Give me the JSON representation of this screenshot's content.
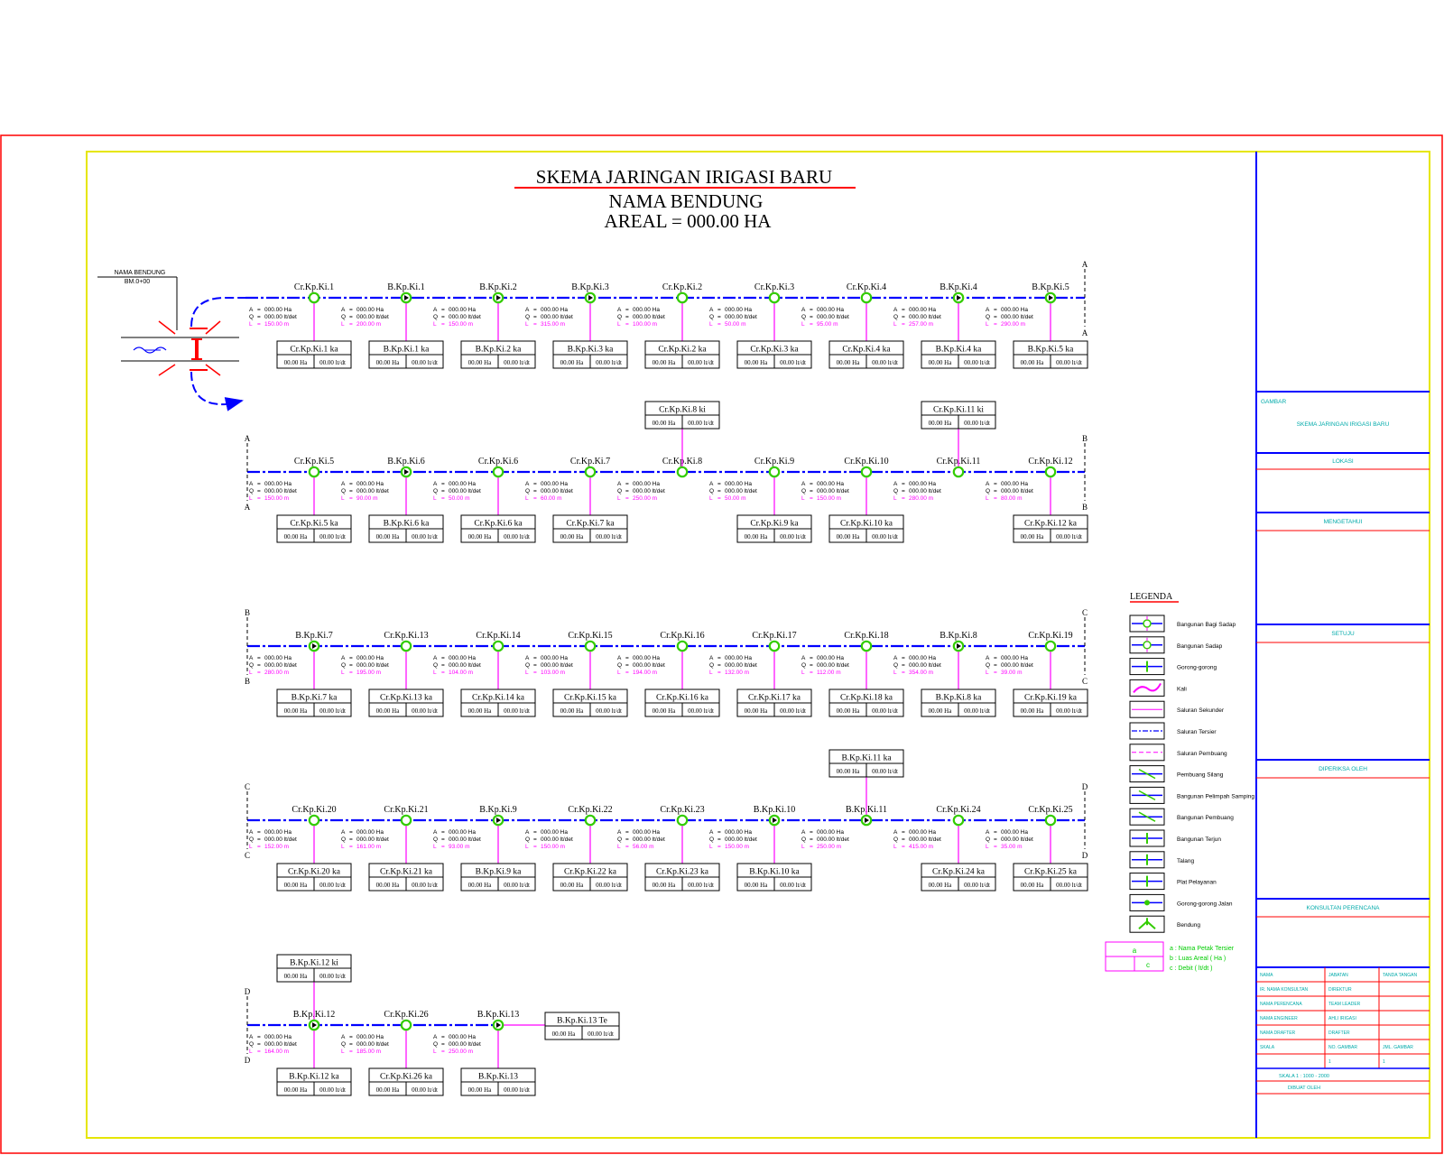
{
  "title": {
    "line1": "SKEMA JARINGAN IRIGASI BARU",
    "line2": "NAMA BENDUNG",
    "line3": "AREAL = 000.00 HA"
  },
  "colors": {
    "channel": "#0000ff",
    "offtake": "#ff00ff",
    "structure": "#33cc00",
    "border_outer": "#ff0000",
    "border_inner": "#ffff00",
    "legend_text": "#00cc00",
    "panel_text": "#00aaaa"
  },
  "weir": {
    "label": "NAMA BENDUNG",
    "sublabel": "BM.0+00"
  },
  "abl": {
    "a": "A",
    "q": "Q",
    "l": "L"
  },
  "rows": [
    {
      "start": null,
      "end": "A",
      "nodes": [
        {
          "name": "Cr.Kp.Ki.1",
          "type": "cross",
          "a": "000.00 Ha",
          "q": "000.00 lt/det",
          "l": "150.00 m",
          "off": "Cr.Kp.Ki.1 ka",
          "area": "00.00 Ha",
          "flow": "00.00 lt/dt"
        },
        {
          "name": "B.Kp.Ki.1",
          "type": "div",
          "a": "000.00 Ha",
          "q": "000.00 lt/det",
          "l": "200.00 m",
          "off": "B.Kp.Ki.1 ka",
          "area": "00.00 Ha",
          "flow": "00.00 lt/dt"
        },
        {
          "name": "B.Kp.Ki.2",
          "type": "div",
          "a": "000.00 Ha",
          "q": "000.00 lt/det",
          "l": "150.00 m",
          "off": "B.Kp.Ki.2 ka",
          "area": "00.00 Ha",
          "flow": "00.00 lt/dt"
        },
        {
          "name": "B.Kp.Ki.3",
          "type": "div",
          "a": "000.00 Ha",
          "q": "000.00 lt/det",
          "l": "315.00 m",
          "off": "B.Kp.Ki.3 ka",
          "area": "00.00 Ha",
          "flow": "00.00 lt/dt"
        },
        {
          "name": "Cr.Kp.Ki.2",
          "type": "cross",
          "a": "000.00 Ha",
          "q": "000.00 lt/det",
          "l": "100.00 m",
          "off": "Cr.Kp.Ki.2 ka",
          "area": "00.00 Ha",
          "flow": "00.00 lt/dt"
        },
        {
          "name": "Cr.Kp.Ki.3",
          "type": "cross",
          "a": "000.00 Ha",
          "q": "000.00 lt/det",
          "l": "50.00 m",
          "off": "Cr.Kp.Ki.3 ka",
          "area": "00.00 Ha",
          "flow": "00.00 lt/dt"
        },
        {
          "name": "Cr.Kp.Ki.4",
          "type": "cross",
          "a": "000.00 Ha",
          "q": "000.00 lt/det",
          "l": "95.00 m",
          "off": "Cr.Kp.Ki.4 ka",
          "area": "00.00 Ha",
          "flow": "00.00 lt/dt"
        },
        {
          "name": "B.Kp.Ki.4",
          "type": "div",
          "a": "000.00 Ha",
          "q": "000.00 lt/det",
          "l": "257.00 m",
          "off": "B.Kp.Ki.4 ka",
          "area": "00.00 Ha",
          "flow": "00.00 lt/dt"
        },
        {
          "name": "B.Kp.Ki.5",
          "type": "div",
          "a": "000.00 Ha",
          "q": "000.00 lt/det",
          "l": "290.00 m",
          "off": "B.Kp.Ki.5 ka",
          "area": "00.00 Ha",
          "flow": "00.00 lt/dt"
        }
      ]
    },
    {
      "start": "A",
      "end": "B",
      "nodes": [
        {
          "name": "Cr.Kp.Ki.5",
          "type": "cross",
          "a": "000.00 Ha",
          "q": "000.00 lt/det",
          "l": "150.00 m",
          "off": "Cr.Kp.Ki.5 ka",
          "area": "00.00 Ha",
          "flow": "00.00 lt/dt"
        },
        {
          "name": "B.Kp.Ki.6",
          "type": "div",
          "a": "000.00 Ha",
          "q": "000.00 lt/det",
          "l": "90.00 m",
          "off": "B.Kp.Ki.6 ka",
          "area": "00.00 Ha",
          "flow": "00.00 lt/dt"
        },
        {
          "name": "Cr.Kp.Ki.6",
          "type": "cross",
          "a": "000.00 Ha",
          "q": "000.00 lt/det",
          "l": "50.00 m",
          "off": "Cr.Kp.Ki.6 ka",
          "area": "00.00 Ha",
          "flow": "00.00 lt/dt"
        },
        {
          "name": "Cr.Kp.Ki.7",
          "type": "cross",
          "a": "000.00 Ha",
          "q": "000.00 lt/det",
          "l": "60.00 m",
          "off": "Cr.Kp.Ki.7 ka",
          "area": "00.00 Ha",
          "flow": "00.00 lt/dt"
        },
        {
          "name": "Cr.Kp.Ki.8",
          "type": "cross",
          "a": "000.00 Ha",
          "q": "000.00 lt/det",
          "l": "250.00 m",
          "top": "Cr.Kp.Ki.8 ki",
          "top_area": "00.00 Ha",
          "top_flow": "00.00 lt/dt"
        },
        {
          "name": "Cr.Kp.Ki.9",
          "type": "cross",
          "a": "000.00 Ha",
          "q": "000.00 lt/det",
          "l": "50.00 m",
          "off": "Cr.Kp.Ki.9 ka",
          "area": "00.00 Ha",
          "flow": "00.00 lt/dt"
        },
        {
          "name": "Cr.Kp.Ki.10",
          "type": "cross",
          "a": "000.00 Ha",
          "q": "000.00 lt/det",
          "l": "150.00 m",
          "off": "Cr.Kp.Ki.10 ka",
          "area": "00.00 Ha",
          "flow": "00.00 lt/dt"
        },
        {
          "name": "Cr.Kp.Ki.11",
          "type": "cross",
          "a": "000.00 Ha",
          "q": "000.00 lt/det",
          "l": "280.00 m",
          "top": "Cr.Kp.Ki.11 ki",
          "top_area": "00.00 Ha",
          "top_flow": "00.00 lt/dt"
        },
        {
          "name": "Cr.Kp.Ki.12",
          "type": "cross",
          "a": "000.00 Ha",
          "q": "000.00 lt/det",
          "l": "80.00 m",
          "off": "Cr.Kp.Ki.12 ka",
          "area": "00.00 Ha",
          "flow": "00.00 lt/dt"
        }
      ]
    },
    {
      "start": "B",
      "end": "C",
      "nodes": [
        {
          "name": "B.Kp.Ki.7",
          "type": "div",
          "a": "000.00 Ha",
          "q": "000.00 lt/det",
          "l": "280.00 m",
          "off": "B.Kp.Ki.7 ka",
          "area": "00.00 Ha",
          "flow": "00.00 lt/dt"
        },
        {
          "name": "Cr.Kp.Ki.13",
          "type": "cross",
          "a": "000.00 Ha",
          "q": "000.00 lt/det",
          "l": "195.00 m",
          "off": "Cr.Kp.Ki.13 ka",
          "area": "00.00 Ha",
          "flow": "00.00 lt/dt"
        },
        {
          "name": "Cr.Kp.Ki.14",
          "type": "cross",
          "a": "000.00 Ha",
          "q": "000.00 lt/det",
          "l": "104.00 m",
          "off": "Cr.Kp.Ki.14 ka",
          "area": "00.00 Ha",
          "flow": "00.00 lt/dt"
        },
        {
          "name": "Cr.Kp.Ki.15",
          "type": "cross",
          "a": "000.00 Ha",
          "q": "000.00 lt/det",
          "l": "103.00 m",
          "off": "Cr.Kp.Ki.15 ka",
          "area": "00.00 Ha",
          "flow": "00.00 lt/dt"
        },
        {
          "name": "Cr.Kp.Ki.16",
          "type": "cross",
          "a": "000.00 Ha",
          "q": "000.00 lt/det",
          "l": "194.00 m",
          "off": "Cr.Kp.Ki.16 ka",
          "area": "00.00 Ha",
          "flow": "00.00 lt/dt"
        },
        {
          "name": "Cr.Kp.Ki.17",
          "type": "cross",
          "a": "000.00 Ha",
          "q": "000.00 lt/det",
          "l": "132.00 m",
          "off": "Cr.Kp.Ki.17 ka",
          "area": "00.00 Ha",
          "flow": "00.00 lt/dt"
        },
        {
          "name": "Cr.Kp.Ki.18",
          "type": "cross",
          "a": "000.00 Ha",
          "q": "000.00 lt/det",
          "l": "112.00 m",
          "off": "Cr.Kp.Ki.18 ka",
          "area": "00.00 Ha",
          "flow": "00.00 lt/dt"
        },
        {
          "name": "B.Kp.Ki.8",
          "type": "div",
          "a": "000.00 Ha",
          "q": "000.00 lt/det",
          "l": "354.00 m",
          "off": "B.Kp.Ki.8 ka",
          "area": "00.00 Ha",
          "flow": "00.00 lt/dt"
        },
        {
          "name": "Cr.Kp.Ki.19",
          "type": "cross",
          "a": "000.00 Ha",
          "q": "000.00 lt/det",
          "l": "39.00 m",
          "off": "Cr.Kp.Ki.19 ka",
          "area": "00.00 Ha",
          "flow": "00.00 lt/dt"
        }
      ]
    },
    {
      "start": "C",
      "end": "D",
      "nodes": [
        {
          "name": "Cr.Kp.Ki.20",
          "type": "cross",
          "a": "000.00 Ha",
          "q": "000.00 lt/det",
          "l": "152.00 m",
          "off": "Cr.Kp.Ki.20 ka",
          "area": "00.00 Ha",
          "flow": "00.00 lt/dt"
        },
        {
          "name": "Cr.Kp.Ki.21",
          "type": "cross",
          "a": "000.00 Ha",
          "q": "000.00 lt/det",
          "l": "161.00 m",
          "off": "Cr.Kp.Ki.21 ka",
          "area": "00.00 Ha",
          "flow": "00.00 lt/dt"
        },
        {
          "name": "B.Kp.Ki.9",
          "type": "div",
          "a": "000.00 Ha",
          "q": "000.00 lt/det",
          "l": "93.00 m",
          "off": "B.Kp.Ki.9 ka",
          "area": "00.00 Ha",
          "flow": "00.00 lt/dt"
        },
        {
          "name": "Cr.Kp.Ki.22",
          "type": "cross",
          "a": "000.00 Ha",
          "q": "000.00 lt/det",
          "l": "150.00 m",
          "off": "Cr.Kp.Ki.22 ka",
          "area": "00.00 Ha",
          "flow": "00.00 lt/dt"
        },
        {
          "name": "Cr.Kp.Ki.23",
          "type": "cross",
          "a": "000.00 Ha",
          "q": "000.00 lt/det",
          "l": "56.00 m",
          "off": "Cr.Kp.Ki.23 ka",
          "area": "00.00 Ha",
          "flow": "00.00 lt/dt"
        },
        {
          "name": "B.Kp.Ki.10",
          "type": "div",
          "a": "000.00 Ha",
          "q": "000.00 lt/det",
          "l": "150.00 m",
          "off": "B.Kp.Ki.10 ka",
          "area": "00.00 Ha",
          "flow": "00.00 lt/dt"
        },
        {
          "name": "B.Kp.Ki.11",
          "type": "div",
          "a": "000.00 Ha",
          "q": "000.00 lt/det",
          "l": "250.00 m",
          "top": "B.Kp.Ki.11 ka",
          "top_area": "00.00 Ha",
          "top_flow": "00.00 lt/dt"
        },
        {
          "name": "Cr.Kp.Ki.24",
          "type": "cross",
          "a": "000.00 Ha",
          "q": "000.00 lt/det",
          "l": "415.00 m",
          "off": "Cr.Kp.Ki.24 ka",
          "area": "00.00 Ha",
          "flow": "00.00 lt/dt"
        },
        {
          "name": "Cr.Kp.Ki.25",
          "type": "cross",
          "a": "000.00 Ha",
          "q": "000.00 lt/det",
          "l": "35.00 m",
          "off": "Cr.Kp.Ki.25 ka",
          "area": "00.00 Ha",
          "flow": "00.00 lt/dt"
        }
      ]
    },
    {
      "start": "D",
      "end": null,
      "nodes": [
        {
          "name": "B.Kp.Ki.12",
          "type": "div",
          "a": "000.00 Ha",
          "q": "000.00 lt/det",
          "l": "164.00 m",
          "off": "B.Kp.Ki.12 ka",
          "area": "00.00 Ha",
          "flow": "00.00 lt/dt",
          "top": "B.Kp.Ki.12 ki",
          "top_area": "00.00 Ha",
          "top_flow": "00.00 lt/dt"
        },
        {
          "name": "Cr.Kp.Ki.26",
          "type": "cross",
          "a": "000.00 Ha",
          "q": "000.00 lt/det",
          "l": "185.00 m",
          "off": "Cr.Kp.Ki.26 ka",
          "area": "00.00 Ha",
          "flow": "00.00 lt/dt"
        },
        {
          "name": "B.Kp.Ki.13",
          "type": "div",
          "a": "000.00 Ha",
          "q": "000.00 lt/det",
          "l": "250.00 m",
          "off": "B.Kp.Ki.13",
          "area": "00.00 Ha",
          "flow": "00.00 lt/dt",
          "right": "B.Kp.Ki.13 Te",
          "right_area": "00.00 Ha",
          "right_flow": "00.00 lt/dt"
        }
      ]
    }
  ],
  "legend": {
    "title": "LEGENDA",
    "items": [
      {
        "label": "Bangunan Bagi Sadap",
        "icon": "bagi-sadap"
      },
      {
        "label": "Bangunan Sadap",
        "icon": "sadap"
      },
      {
        "label": "Gorong-gorong",
        "icon": "gorong"
      },
      {
        "label": "Kali",
        "icon": "kali"
      },
      {
        "label": "Saluran Sekunder",
        "icon": "sekunder"
      },
      {
        "label": "Saluran Tersier",
        "icon": "tersier"
      },
      {
        "label": "Saluran Pembuang",
        "icon": "pembuang"
      },
      {
        "label": "Pembuang Silang",
        "icon": "silang"
      },
      {
        "label": "Bangunan Pelimpah Samping",
        "icon": "pelimpah"
      },
      {
        "label": "Bangunan Pembuang",
        "icon": "bpembuang"
      },
      {
        "label": "Bangunan Terjun",
        "icon": "terjun"
      },
      {
        "label": "Talang",
        "icon": "talang"
      },
      {
        "label": "Plat Pelayanan",
        "icon": "plat"
      },
      {
        "label": "Gorong-gorong Jalan",
        "icon": "gorong-jalan"
      },
      {
        "label": "Bendung",
        "icon": "bendung"
      }
    ],
    "key": {
      "a": "a",
      "c": "c",
      "lines": [
        "a : Nama Petak Tersier",
        "b : Luas Areal ( Ha )",
        "c : Debit ( lt/dt )"
      ]
    }
  },
  "panel": {
    "gambar_label": "GAMBAR",
    "gambar_value": "SKEMA JARINGAN IRIGASI BARU",
    "lokasi": "LOKASI",
    "mengetahui": "MENGETAHUI",
    "setuju": "SETUJU",
    "diperiksa": "DIPERIKSA OLEH",
    "konsultan": "KONSULTAN PERENCANA",
    "grid": [
      [
        "NAMA",
        "JABATAN",
        "TANDA TANGAN"
      ],
      [
        "IR. NAMA KONSULTAN",
        "DIREKTUR",
        ""
      ],
      [
        "NAMA PERENCANA",
        "TEAM LEADER",
        ""
      ],
      [
        "NAMA ENGINEER",
        "AHLI IRIGASI",
        ""
      ],
      [
        "NAMA DRAFTER",
        "DRAFTER",
        ""
      ],
      [
        "SKALA",
        "NO. GAMBAR",
        "JML. GAMBAR"
      ],
      [
        "",
        "1",
        "1"
      ]
    ],
    "footer1": "SKALA 1 : 1000 - 2000",
    "footer2": "DIBUAT OLEH"
  }
}
